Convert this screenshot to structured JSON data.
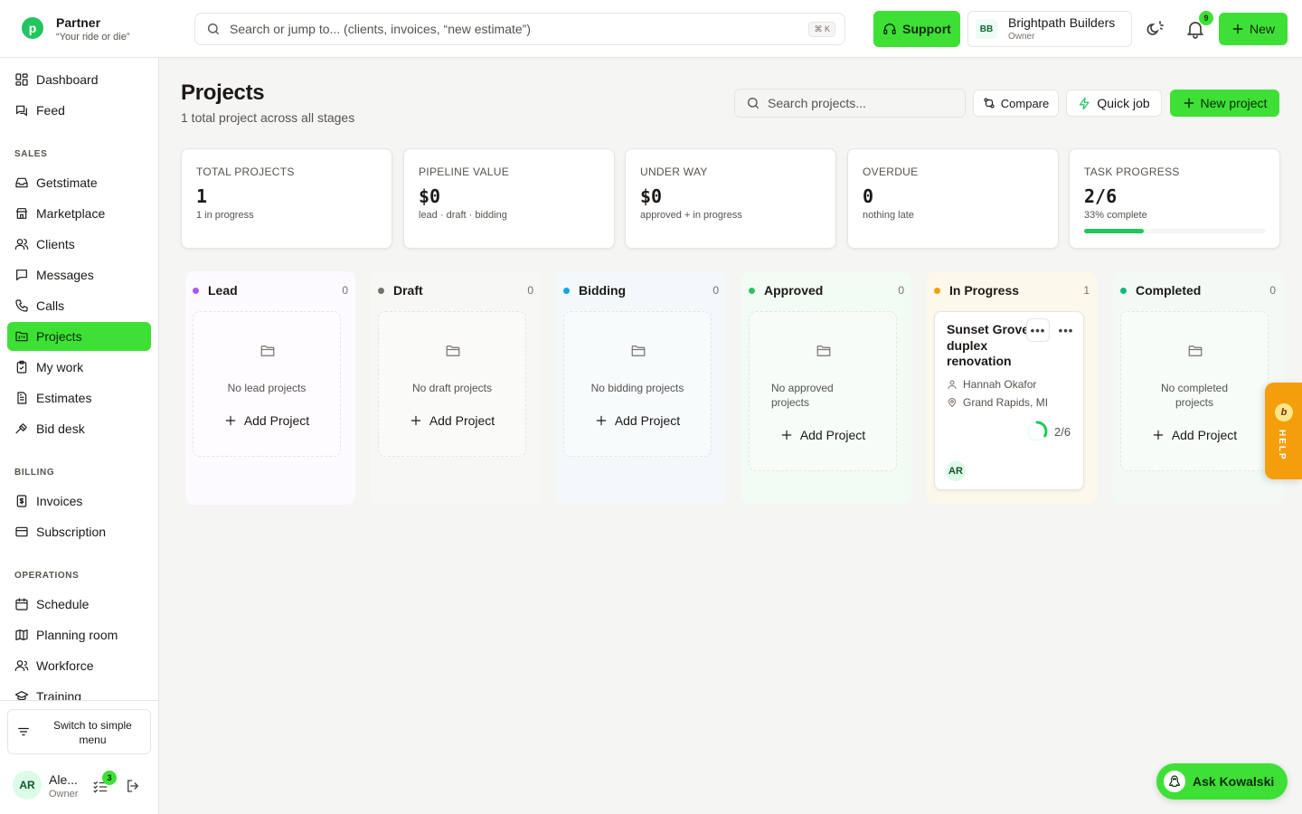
{
  "brand": {
    "name": "Partner",
    "tagline": "“Your ride or die”",
    "logo_letter": "p"
  },
  "search": {
    "placeholder": "Search or jump to... (clients, invoices, “new estimate”)",
    "shortcut": "⌘ K"
  },
  "header": {
    "support_label": "Support",
    "org": {
      "initials": "BB",
      "name": "Brightpath Builders",
      "role": "Owner"
    },
    "notification_count": "9",
    "new_label": "New"
  },
  "sidebar": {
    "top_items": [
      {
        "label": "Dashboard",
        "icon": "dashboard-icon"
      },
      {
        "label": "Feed",
        "icon": "feed-icon"
      }
    ],
    "sections": [
      {
        "title": "SALES",
        "items": [
          {
            "label": "Getstimate",
            "icon": "inbox-icon"
          },
          {
            "label": "Marketplace",
            "icon": "store-icon"
          },
          {
            "label": "Clients",
            "icon": "users-icon"
          },
          {
            "label": "Messages",
            "icon": "message-icon"
          },
          {
            "label": "Calls",
            "icon": "phone-icon"
          },
          {
            "label": "Projects",
            "icon": "folder-kanban-icon",
            "active": true
          },
          {
            "label": "My work",
            "icon": "clipboard-check-icon"
          },
          {
            "label": "Estimates",
            "icon": "file-text-icon"
          },
          {
            "label": "Bid desk",
            "icon": "gavel-icon"
          }
        ]
      },
      {
        "title": "BILLING",
        "items": [
          {
            "label": "Invoices",
            "icon": "receipt-icon"
          },
          {
            "label": "Subscription",
            "icon": "credit-card-icon"
          }
        ]
      },
      {
        "title": "OPERATIONS",
        "items": [
          {
            "label": "Schedule",
            "icon": "calendar-icon"
          },
          {
            "label": "Planning room",
            "icon": "map-icon"
          },
          {
            "label": "Workforce",
            "icon": "user-group-icon"
          },
          {
            "label": "Training",
            "icon": "graduation-cap-icon"
          }
        ]
      }
    ],
    "switch_menu_label": "Switch to simple menu",
    "user": {
      "initials": "AR",
      "name": "Ale...",
      "role": "Owner",
      "task_count": "3"
    }
  },
  "page": {
    "title": "Projects",
    "subtitle": "1 total project across all stages",
    "search_placeholder": "Search projects...",
    "compare_label": "Compare",
    "quick_job_label": "Quick job",
    "new_project_label": "New project"
  },
  "stats": [
    {
      "label": "TOTAL PROJECTS",
      "value": "1",
      "desc": "1 in progress"
    },
    {
      "label": "PIPELINE VALUE",
      "value": "$0",
      "desc": "lead · draft · bidding"
    },
    {
      "label": "UNDER WAY",
      "value": "$0",
      "desc": "approved + in progress"
    },
    {
      "label": "OVERDUE",
      "value": "0",
      "desc": "nothing late"
    },
    {
      "label": "TASK PROGRESS",
      "value": "2/6",
      "desc": "33% complete",
      "progress_fraction": 0.33
    }
  ],
  "columns": [
    {
      "name": "Lead",
      "count": "0",
      "dot_color": "#a855f7",
      "tint": "#fdfbff",
      "empty_text": "No lead projects",
      "add_label": "Add Project"
    },
    {
      "name": "Draft",
      "count": "0",
      "dot_color": "#78716c",
      "tint": "#f7f7f6",
      "empty_text": "No draft projects",
      "add_label": "Add Project"
    },
    {
      "name": "Bidding",
      "count": "0",
      "dot_color": "#0ea5e9",
      "tint": "#f3f9fb",
      "empty_text": "No bidding projects",
      "add_label": "Add Project"
    },
    {
      "name": "Approved",
      "count": "0",
      "dot_color": "#22c55e",
      "tint": "#f2fbf4",
      "empty_text": "No approved projects",
      "add_label": "Add Project"
    },
    {
      "name": "In Progress",
      "count": "1",
      "dot_color": "#f59e0b",
      "tint": "#fcf9ec",
      "empty_text": "",
      "add_label": ""
    },
    {
      "name": "Completed",
      "count": "0",
      "dot_color": "#10b981",
      "tint": "#f3faf6",
      "empty_text": "No completed projects",
      "add_label": "Add Project"
    }
  ],
  "project_card": {
    "title": "Sunset Grove duplex renovation",
    "client": "Hannah Okafor",
    "location": "Grand Rapids, MI",
    "progress_text": "2/6",
    "progress_fraction": 0.33,
    "assignee_initials": "AR",
    "more_glyph": "•••"
  },
  "help_tab": {
    "label": "HELP",
    "icon_letter": "b"
  },
  "assistant": {
    "label": "Ask Kowalski"
  },
  "colors": {
    "accent": "#3ee036",
    "help": "#f59e0b",
    "progress": "#22c55e"
  }
}
